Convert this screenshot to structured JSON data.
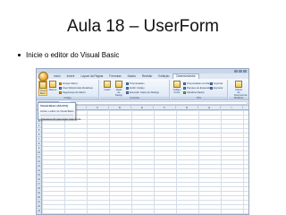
{
  "slide": {
    "title": "Aula 18 – UserForm",
    "bullets": [
      "Inicie o editor do Visual Basic"
    ]
  },
  "excel": {
    "tabs": [
      "Início",
      "Inserir",
      "Layout da Página",
      "Fórmulas",
      "Dados",
      "Revisão",
      "Exibição",
      "Desenvolvedor"
    ],
    "active_tab_index": 7,
    "ribbon": {
      "code_group": {
        "label": "Código",
        "visual_basic": "Visual Basic",
        "macros": "Macros",
        "record_macro": "Gravar Macro",
        "relative_refs": "Usar Referências Relativas",
        "macro_security": "Segurança de Macro"
      },
      "controls_group": {
        "label": "Controles",
        "insert": "Inserir",
        "design_mode": "Modo de Design",
        "properties": "Propriedades",
        "view_code": "Exibir Código",
        "run_dialog": "Executar Caixa de Diálogo"
      },
      "xml_group": {
        "label": "XML",
        "source": "Código-Fonte",
        "map_props": "Propriedades do Mapa",
        "expansion_packs": "Pacotes de Expansão",
        "refresh_data": "Atualizar Dados",
        "import": "Importar",
        "export": "Exportar"
      },
      "modify_group": {
        "label": "Modificar",
        "doc_panel": "Painel de Documentos"
      }
    },
    "formula_bar": {
      "fx": "fx"
    },
    "columns": [
      "A",
      "B",
      "C",
      "D",
      "E",
      "F",
      "G",
      "H",
      "I"
    ],
    "rows": [
      "1",
      "2",
      "3",
      "4",
      "5",
      "6",
      "7",
      "8",
      "9",
      "10",
      "11",
      "12",
      "13",
      "14",
      "15",
      "16",
      "17",
      "18",
      "19",
      "20",
      "21",
      "22",
      "23"
    ],
    "tooltip": {
      "title": "Visual Basic (Alt+F11)",
      "description": "Iniciar o editor do Visual Basic.",
      "help": "Pressione F1 para obter mais ajuda."
    },
    "accent_color": "#e8a536"
  }
}
